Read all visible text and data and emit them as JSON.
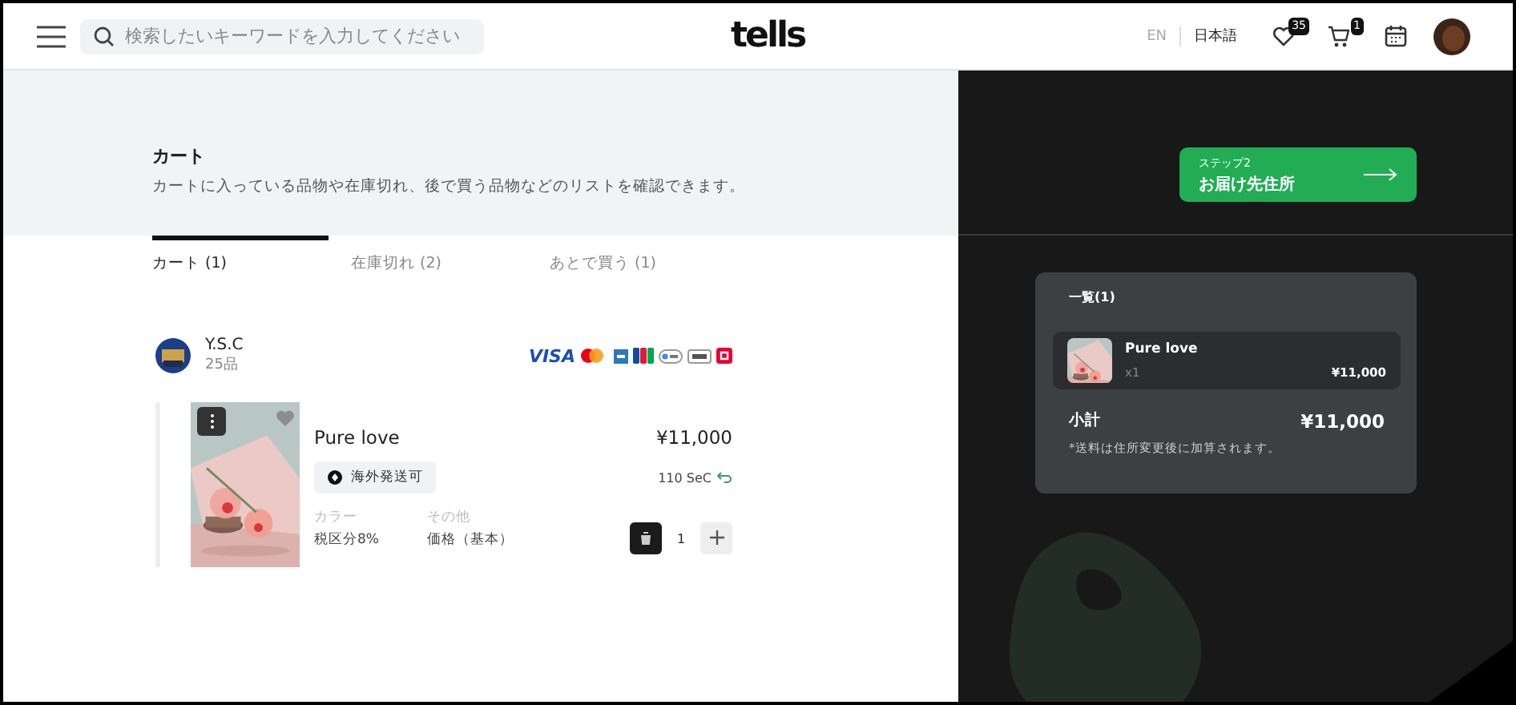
{
  "header": {
    "search": {
      "placeholder": "検索したいキーワードを入力してください"
    },
    "logo": "tells",
    "languages": [
      {
        "label": "EN",
        "selected": false
      },
      {
        "label": "日本語",
        "selected": true
      }
    ],
    "favorites_count": "35",
    "cart_count": "1"
  },
  "page": {
    "title": "カート",
    "description": "カートに入っている品物や在庫切れ、後で買う品物などのリストを確認できます。"
  },
  "tabs": [
    {
      "label": "カート (1)",
      "selected": true
    },
    {
      "label": "在庫切れ (2)",
      "selected": false
    },
    {
      "label": "あとで買う (1)",
      "selected": false
    }
  ],
  "shop": {
    "name": "Y.S.C",
    "count": "25品",
    "payment_brand": "VISA"
  },
  "items": [
    {
      "name": "Pure love",
      "price": "¥11,000",
      "badge": "海外発送可",
      "points": "110 SeC",
      "favorited": false,
      "attributes": [
        {
          "label": "カラー",
          "value": "税区分8%"
        },
        {
          "label": "その他",
          "value": "価格（基本）"
        }
      ],
      "quantity": "1"
    }
  ],
  "step_button": {
    "step": "ステップ2",
    "label": "お届け先住所"
  },
  "summary": {
    "title": "一覧(1)",
    "items": [
      {
        "name": "Pure love",
        "quantity": "x1",
        "price": "¥11,000"
      }
    ],
    "subtotal_label": "小計",
    "subtotal": "¥11,000",
    "note": "*送料は住所変更後に加算されます。"
  }
}
